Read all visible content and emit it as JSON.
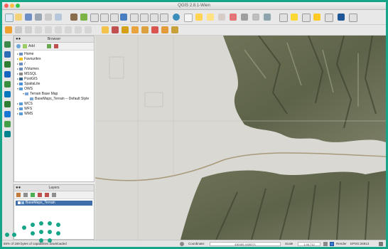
{
  "window": {
    "title": "QGIS 2.8.1-Wien"
  },
  "browser_panel": {
    "title": "Browser",
    "add_label": "Add",
    "items": [
      {
        "label": "Home",
        "indent": 0
      },
      {
        "label": "Favourites",
        "indent": 0
      },
      {
        "label": "/",
        "indent": 0
      },
      {
        "label": "/Volumes",
        "indent": 0
      },
      {
        "label": "MSSQL",
        "indent": 0
      },
      {
        "label": "PostGIS",
        "indent": 0
      },
      {
        "label": "SpatiaLite",
        "indent": 0
      },
      {
        "label": "OWS",
        "indent": 0
      },
      {
        "label": "Terrain Base Map",
        "indent": 1
      },
      {
        "label": "BaseMaps_Terrain -- Default Style",
        "indent": 2
      },
      {
        "label": "WCS",
        "indent": 0
      },
      {
        "label": "WFS",
        "indent": 0
      },
      {
        "label": "WMS",
        "indent": 0
      }
    ]
  },
  "layers_panel": {
    "title": "Layers",
    "layers": [
      {
        "label": "BaseMaps_Terrain"
      }
    ]
  },
  "statusbar": {
    "message": "65% of 169 bytes of capabilities downloaded",
    "coordinate_label": "Coordinate:",
    "coordinate_value": "436485,4436071",
    "scale_label": "Scale",
    "scale_value": "1:46,712",
    "render_label": "Render",
    "crs": "EPSG:26913"
  },
  "icons": [
    "new-project-icon",
    "open-icon",
    "save-icon",
    "print-icon",
    "pan-icon",
    "zoom-in-icon",
    "zoom-out-icon",
    "identify-icon",
    "measure-icon",
    "refresh-icon",
    "help-icon"
  ]
}
